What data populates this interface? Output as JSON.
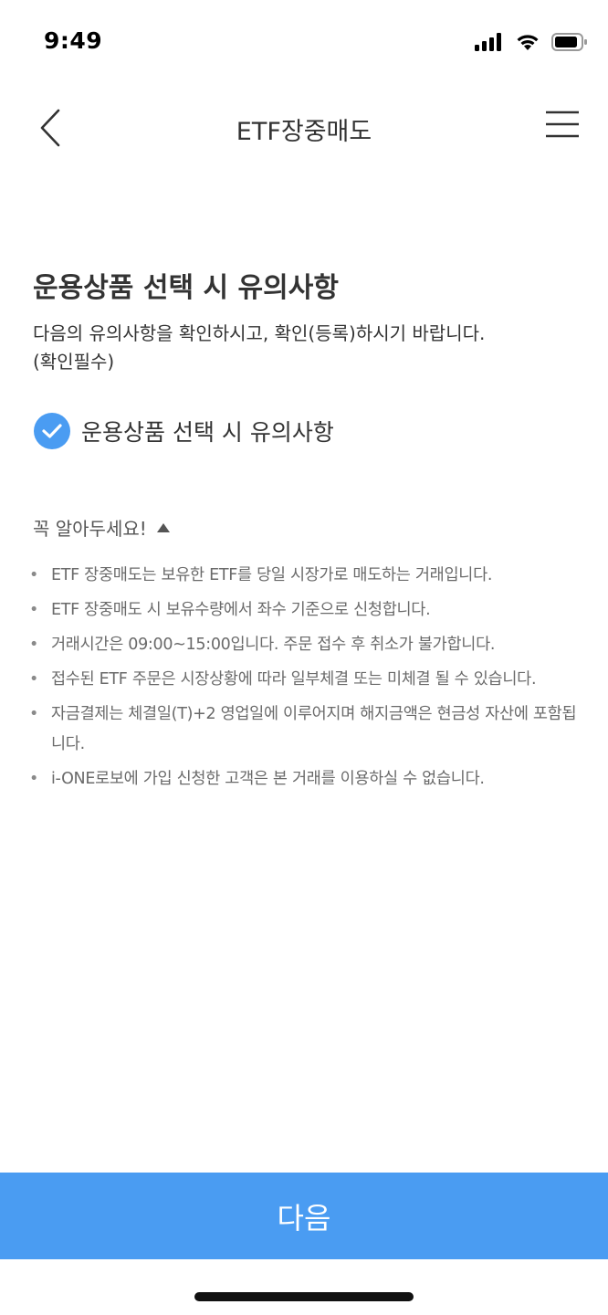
{
  "status_bar": {
    "time": "9:49",
    "icons": [
      "signal-icon",
      "wifi-icon",
      "battery-icon"
    ]
  },
  "nav": {
    "title": "ETF장중매도",
    "back_icon": "chevron-left-icon",
    "menu_icon": "hamburger-menu-icon"
  },
  "main": {
    "title": "운용상품 선택 시 유의사항",
    "description": "다음의 유의사항을 확인하시고, 확인(등록)하시기 바랍니다.(확인필수)",
    "checkbox": {
      "label": "운용상품 선택 시 유의사항",
      "checked": true
    },
    "notice": {
      "toggle_label": "꼭 알아두세요!",
      "expanded": true,
      "items": [
        "ETF 장중매도는 보유한 ETF를 당일 시장가로 매도하는 거래입니다.",
        "ETF 장중매도 시 보유수량에서 좌수 기준으로 신청합니다.",
        "거래시간은 09:00~15:00입니다. 주문 접수 후 취소가 불가합니다.",
        "접수된 ETF 주문은 시장상황에 따라 일부체결 또는 미체결 될 수 있습니다.",
        "자금결제는 체결일(T)+2 영업일에 이루어지며 해지금액은 현금성 자산에 포함됩니다.",
        "i-ONE로보에 가입 신청한 고객은 본 거래를 이용하실 수 없습니다."
      ]
    }
  },
  "footer": {
    "next_label": "다음"
  },
  "colors": {
    "accent": "#4a9cf2",
    "title_text": "#333333",
    "notice_text": "#6a6a6a"
  }
}
